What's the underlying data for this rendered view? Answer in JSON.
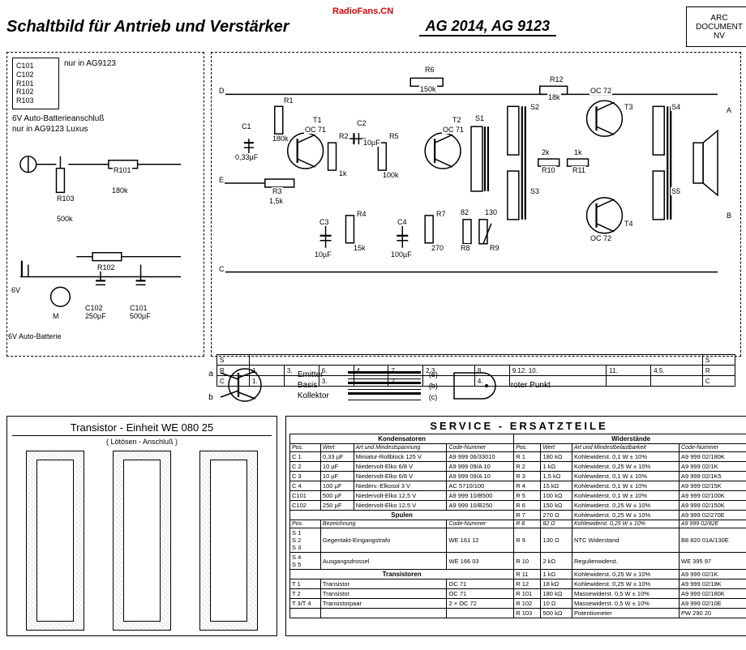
{
  "watermark": "RadioFans.CN",
  "header": {
    "title": "Schaltbild für Antrieb und Verstärker",
    "models": "AG 2014, AG 9123",
    "corner1": "ARC",
    "corner2": "DOCUMENT",
    "corner3": "NV"
  },
  "leftbox": {
    "components": [
      "C101",
      "C102",
      "R101",
      "R102",
      "R103"
    ],
    "only_in": "nur in AG9123",
    "battery_note1": "6V Auto-Batterieanschluß",
    "battery_note2": "nur in AG9123 Luxus",
    "r103": "R103",
    "r103_val": "500k",
    "r101": "R101",
    "r101_val": "180k",
    "r102": "R102",
    "c102": "C102",
    "c102_val": "250µF",
    "c101": "C101",
    "c101_val": "500µF",
    "motor": "M",
    "batt": "6V",
    "batt_label": "6V Auto-Batterie"
  },
  "amp": {
    "nodes": {
      "D": "D",
      "E": "E",
      "C": "C",
      "A": "A",
      "B": "B"
    },
    "parts": {
      "C1": "C1",
      "C1v": "0,33µF",
      "R1": "R1",
      "R1v": "180k",
      "T1": "T1",
      "T1t": "OC 71",
      "R2": "R2",
      "R2v": "1k",
      "C2": "C2",
      "C2v": "10µF",
      "R3": "R3",
      "R3v": "1,5k",
      "C3": "C3",
      "C3v": "10µF",
      "R4": "R4",
      "R4v": "15k",
      "R5": "R5",
      "R5v": "100k",
      "C4": "C4",
      "C4v": "100µF",
      "R6": "R6",
      "R6v": "150k",
      "R7": "R7",
      "R7v": "270",
      "T2": "T2",
      "T2t": "OC 71",
      "S1": "S1",
      "S2": "S2",
      "S3": "S3",
      "S4": "S4",
      "S5": "S5",
      "R8": "R8",
      "R8v": "82",
      "R9": "R9",
      "R9v": "130",
      "R10": "R10",
      "R10v": "2k",
      "R11": "R11",
      "R11v": "1k",
      "R12": "R12",
      "R12v": "18k",
      "T3": "T3",
      "T3t": "OC 72",
      "T4": "T4",
      "T4t": "OC 72"
    },
    "stripe": {
      "row1_l": "S",
      "row1_cells": [
        "",
        "",
        "",
        "",
        "",
        "",
        "",
        ""
      ],
      "row1_r": "S",
      "row2_l": "R",
      "row2_cells": [
        "1.",
        "3.",
        "6.",
        "4.",
        "7.",
        "2.3.",
        "8.",
        "9.12. 10.",
        "11.",
        "4.5."
      ],
      "row2_r": "R",
      "row3_l": "C",
      "row3_cells": [
        "1.",
        "",
        "3.",
        "",
        "2.",
        "",
        "4.",
        "",
        "",
        ""
      ],
      "row3_r": "C"
    }
  },
  "legend": {
    "a": "a",
    "b": "b",
    "emitter": "Emitter",
    "emitter_p": "(e)",
    "basis": "Basis",
    "basis_p": "(b)",
    "kollektor": "Kollektor",
    "kollektor_p": "(c)",
    "roter_punkt": "roter Punkt"
  },
  "trans_unit": {
    "title": "Transistor - Einheit  WE 080 25",
    "sub": "( Lötösen - Anschluß )"
  },
  "service": {
    "title": "SERVICE - ERSATZTEILE",
    "kondensatoren": "Kondensatoren",
    "widerstaende": "Widerstände",
    "spulen": "Spulen",
    "transistoren": "Transistoren",
    "col_pos": "Pos.",
    "col_wert": "Wert",
    "col_art": "Art und Mindestspannung",
    "col_code": "Code-Nummer",
    "col_art_w": "Art und Mindestbelastbarkeit",
    "caps": [
      {
        "p": "C 1",
        "w": "0,33 µF",
        "a": "Miniatur-Rollblock 125 V",
        "c": "A9 999 06/33010"
      },
      {
        "p": "C 2",
        "w": "10 µF",
        "a": "Niedervolt-Elko 6/8 V",
        "c": "A9 999 09/A 10"
      },
      {
        "p": "C 3",
        "w": "10 µF",
        "a": "Niedervolt-Elko 6/8 V",
        "c": "A9 999 09/A 10"
      },
      {
        "p": "C 4",
        "w": "100 µF",
        "a": "Niederv.-Elkosol 3 V",
        "c": "AC 5710/100"
      },
      {
        "p": "C101",
        "w": "500 µF",
        "a": "Niedervolt-Elko 12,5 V",
        "c": "A9 999 10/B500"
      },
      {
        "p": "C102",
        "w": "250 µF",
        "a": "Niedervolt-Elko 12,5 V",
        "c": "A9 999 10/B250"
      }
    ],
    "res": [
      {
        "p": "R 1",
        "w": "180 kΩ",
        "a": "Kohlewiderst.  0,1 W ± 10%",
        "c": "A9 999 02/180K"
      },
      {
        "p": "R 2",
        "w": "1 kΩ",
        "a": "Kohlewiderst.  0,25 W ± 10%",
        "c": "A9 999 02/1K"
      },
      {
        "p": "R 3",
        "w": "1,5 kΩ",
        "a": "Kohlewiderst.  0,1 W ± 10%",
        "c": "A9 999 02/1K5"
      },
      {
        "p": "R 4",
        "w": "15 kΩ",
        "a": "Kohlewiderst.  0,1 W ± 10%",
        "c": "A9 999 02/15K"
      },
      {
        "p": "R 5",
        "w": "100 kΩ",
        "a": "Kohlewiderst.  0,1 W ± 10%",
        "c": "A9 999 02/100K"
      },
      {
        "p": "R 6",
        "w": "150 kΩ",
        "a": "Kohlewiderst.  0,25 W ± 10%",
        "c": "A9 999 02/150K"
      },
      {
        "p": "R 7",
        "w": "270 Ω",
        "a": "Kohlewiderst.  0,25 W ± 10%",
        "c": "A9 999 02/270E"
      },
      {
        "p": "R 8",
        "w": "82 Ω",
        "a": "Kohlewiderst.  0,25 W ± 10%",
        "c": "A9 999 02/82E"
      },
      {
        "p": "R 9",
        "w": "130 Ω",
        "a": "NTC Widerstand",
        "c": "B8 820 01A/130E"
      },
      {
        "p": "R 10",
        "w": "2 kΩ",
        "a": "Regulierwiderst.",
        "c": "WE 395 97"
      },
      {
        "p": "R 11",
        "w": "1 kΩ",
        "a": "Kohlewiderst.  0,25 W ± 10%",
        "c": "A9 999 02/1K"
      },
      {
        "p": "R 12",
        "w": "18 kΩ",
        "a": "Kohlewiderst.  0,25 W ± 10%",
        "c": "A9 999 02/18K"
      },
      {
        "p": "R 101",
        "w": "180 kΩ",
        "a": "Massewiderst.  0,5 W ± 10%",
        "c": "A9 999 02/180K"
      },
      {
        "p": "R 102",
        "w": "10 Ω",
        "a": "Massewiderst.  0,5 W ± 10%",
        "c": "A9 999 02/10E"
      },
      {
        "p": "R 103",
        "w": "500 kΩ",
        "a": "Potentiometer",
        "c": "PW 290 20"
      }
    ],
    "coils": [
      {
        "p": "S 1\nS 2\nS 3",
        "a": "Gegentakt-Eingangstrafo",
        "c": "WE 161 12"
      },
      {
        "p": "S 4\nS 5",
        "a": "Ausgangsdrossel",
        "c": "WE 166 03"
      }
    ],
    "trans": [
      {
        "p": "T 1",
        "a": "Transistor",
        "c": "OC 71"
      },
      {
        "p": "T 2",
        "a": "Transistor",
        "c": "OC 71"
      },
      {
        "p": "T 3/T 4",
        "a": "Transistorpaar",
        "c": "2 × OC 72"
      }
    ]
  }
}
